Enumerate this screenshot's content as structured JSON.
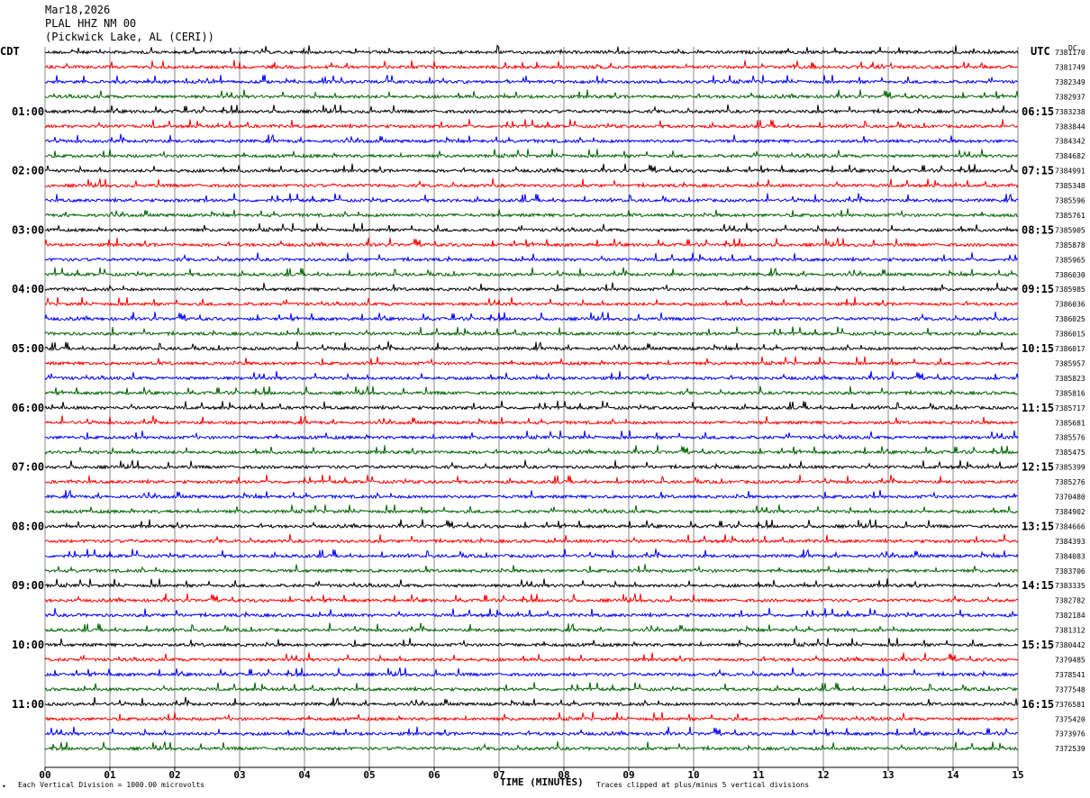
{
  "header": {
    "date": "Mar18,2026",
    "station": "PLAL HHZ NM 00",
    "location": "(Pickwick Lake, AL (CERI))",
    "left_timezone": "CDT",
    "right_timezone": "UTC",
    "dc_label": "DC"
  },
  "footer": {
    "scale_note": "Each Vertical Division = 1000.00 microvolts",
    "clip_note": "Traces clipped at plus/minus 5 vertical divisions",
    "corner_mark": "•"
  },
  "chart_data": {
    "type": "line",
    "title": "",
    "xlabel": "TIME (MINUTES)",
    "ylabel": "",
    "xlim": [
      0,
      15
    ],
    "x_ticks": [
      "00",
      "01",
      "02",
      "03",
      "04",
      "05",
      "06",
      "07",
      "08",
      "09",
      "10",
      "11",
      "12",
      "13",
      "14",
      "15"
    ],
    "grid": "vertical lines each minute",
    "trace_colors": [
      "#000000",
      "#ff0000",
      "#0000ff",
      "#006400"
    ],
    "left_hour_labels": [
      "01:00",
      "02:00",
      "03:00",
      "04:00",
      "05:00",
      "06:00",
      "07:00",
      "08:00",
      "09:00",
      "10:00",
      "11:00"
    ],
    "right_hour_labels": [
      "06:15",
      "07:15",
      "08:15",
      "09:15",
      "10:15",
      "11:15",
      "12:15",
      "13:15",
      "14:15",
      "15:15",
      "16:15"
    ],
    "trace_dc_values": [
      "7381170",
      "7381749",
      "7382349",
      "7382937",
      "7383238",
      "7383844",
      "7384342",
      "7384682",
      "7384991",
      "7385348",
      "7385596",
      "7385761",
      "7385905",
      "7385878",
      "7385965",
      "7386030",
      "7385985",
      "7386036",
      "7386025",
      "7386015",
      "7386017",
      "7385957",
      "7385823",
      "7385816",
      "7385717",
      "7385681",
      "7385576",
      "7385475",
      "7385399",
      "7385276",
      "7370480",
      "7384902",
      "7384666",
      "7384393",
      "7384083",
      "7383706",
      "7383335",
      "7382782",
      "7382184",
      "7381312",
      "7380442",
      "7379485",
      "7378541",
      "7377548",
      "7376581",
      "7375420",
      "7373976",
      "7372539"
    ]
  }
}
